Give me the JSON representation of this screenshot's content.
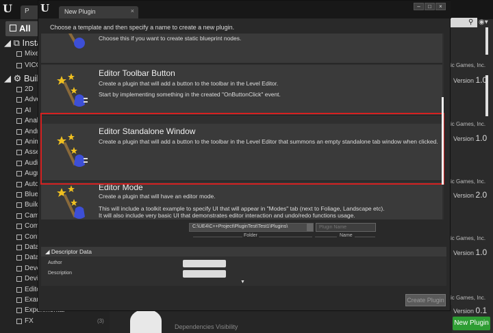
{
  "background": {
    "tab_label": "P",
    "filter_all": "All",
    "sections": {
      "installed": "Insta",
      "built_in": "Built"
    },
    "installed_items": [
      {
        "label": "Mixe"
      },
      {
        "label": "VICO"
      }
    ],
    "built_in_items": [
      {
        "label": "2D"
      },
      {
        "label": "Adve"
      },
      {
        "label": "AI"
      },
      {
        "label": "Anal"
      },
      {
        "label": "Andr"
      },
      {
        "label": "Anim"
      },
      {
        "label": "Asse"
      },
      {
        "label": "Audi"
      },
      {
        "label": "Augr"
      },
      {
        "label": "Auto"
      },
      {
        "label": "Blue"
      },
      {
        "label": "Build"
      },
      {
        "label": "Cam"
      },
      {
        "label": "Com"
      },
      {
        "label": "Cont"
      },
      {
        "label": "Data"
      },
      {
        "label": "Data"
      },
      {
        "label": "Deve"
      },
      {
        "label": "Devi"
      },
      {
        "label": "Edito"
      },
      {
        "label": "Exam"
      },
      {
        "label": "Experimental"
      },
      {
        "label": "FX",
        "count": "(3)"
      }
    ],
    "right_entries": [
      {
        "developer": "ic Games, Inc.",
        "version_label": "Version",
        "version": "1.0"
      },
      {
        "developer": "ic Games, Inc.",
        "version_label": "Version",
        "version": "1.0"
      },
      {
        "developer": "ic Games, Inc.",
        "version_label": "Version",
        "version": "2.0"
      },
      {
        "developer": "ic Games, Inc.",
        "version_label": "Version",
        "version": "1.0"
      },
      {
        "developer": "ic Games, Inc.",
        "version_label": "Version",
        "version": "0.1"
      }
    ],
    "new_plugin_button": "New Plugin",
    "bottom_text": "Dependencies Visibility"
  },
  "dialog": {
    "tab_title": "New Plugin",
    "tab_close": "×",
    "window_buttons": {
      "minimize": "–",
      "maximize": "□",
      "close": "×"
    },
    "subtitle": "Choose a template and then specify a name to create a new plugin.",
    "templates": [
      {
        "title": "",
        "description_lines": [
          "Choose this if you want to create static blueprint nodes."
        ]
      },
      {
        "title": "Editor Toolbar Button",
        "description_lines": [
          "Create a plugin that will add a button to the toolbar in the Level Editor.",
          "Start by implementing something in the created \"OnButtonClick\" event."
        ]
      },
      {
        "title": "Editor Standalone Window",
        "description_lines": [
          "Create a plugin that will add a button to the toolbar in the Level Editor that summons an empty standalone tab window when clicked."
        ]
      },
      {
        "title": "Editor Mode",
        "description_lines": [
          "Create a plugin that will have an editor mode.",
          "This will include a toolkit example to specify UI that will appear in \"Modes\" tab (next to Foliage, Landscape etc).",
          "It will also include very basic UI that demonstrates editor interaction and undo/redo functions usage."
        ]
      }
    ],
    "folder_path": "C:\\UE4\\C++Project\\PluginTest\\Test1\\Plugins\\",
    "folder_label": "Folder",
    "name_placeholder": "Plugin Name",
    "name_label": "Name",
    "descriptor": {
      "header": "Descriptor Data",
      "author_label": "Author",
      "description_label": "Description"
    },
    "create_button": "Create Plugin"
  },
  "colors": {
    "highlight": "#d62020",
    "new_plugin_green": "#2e9d33"
  }
}
